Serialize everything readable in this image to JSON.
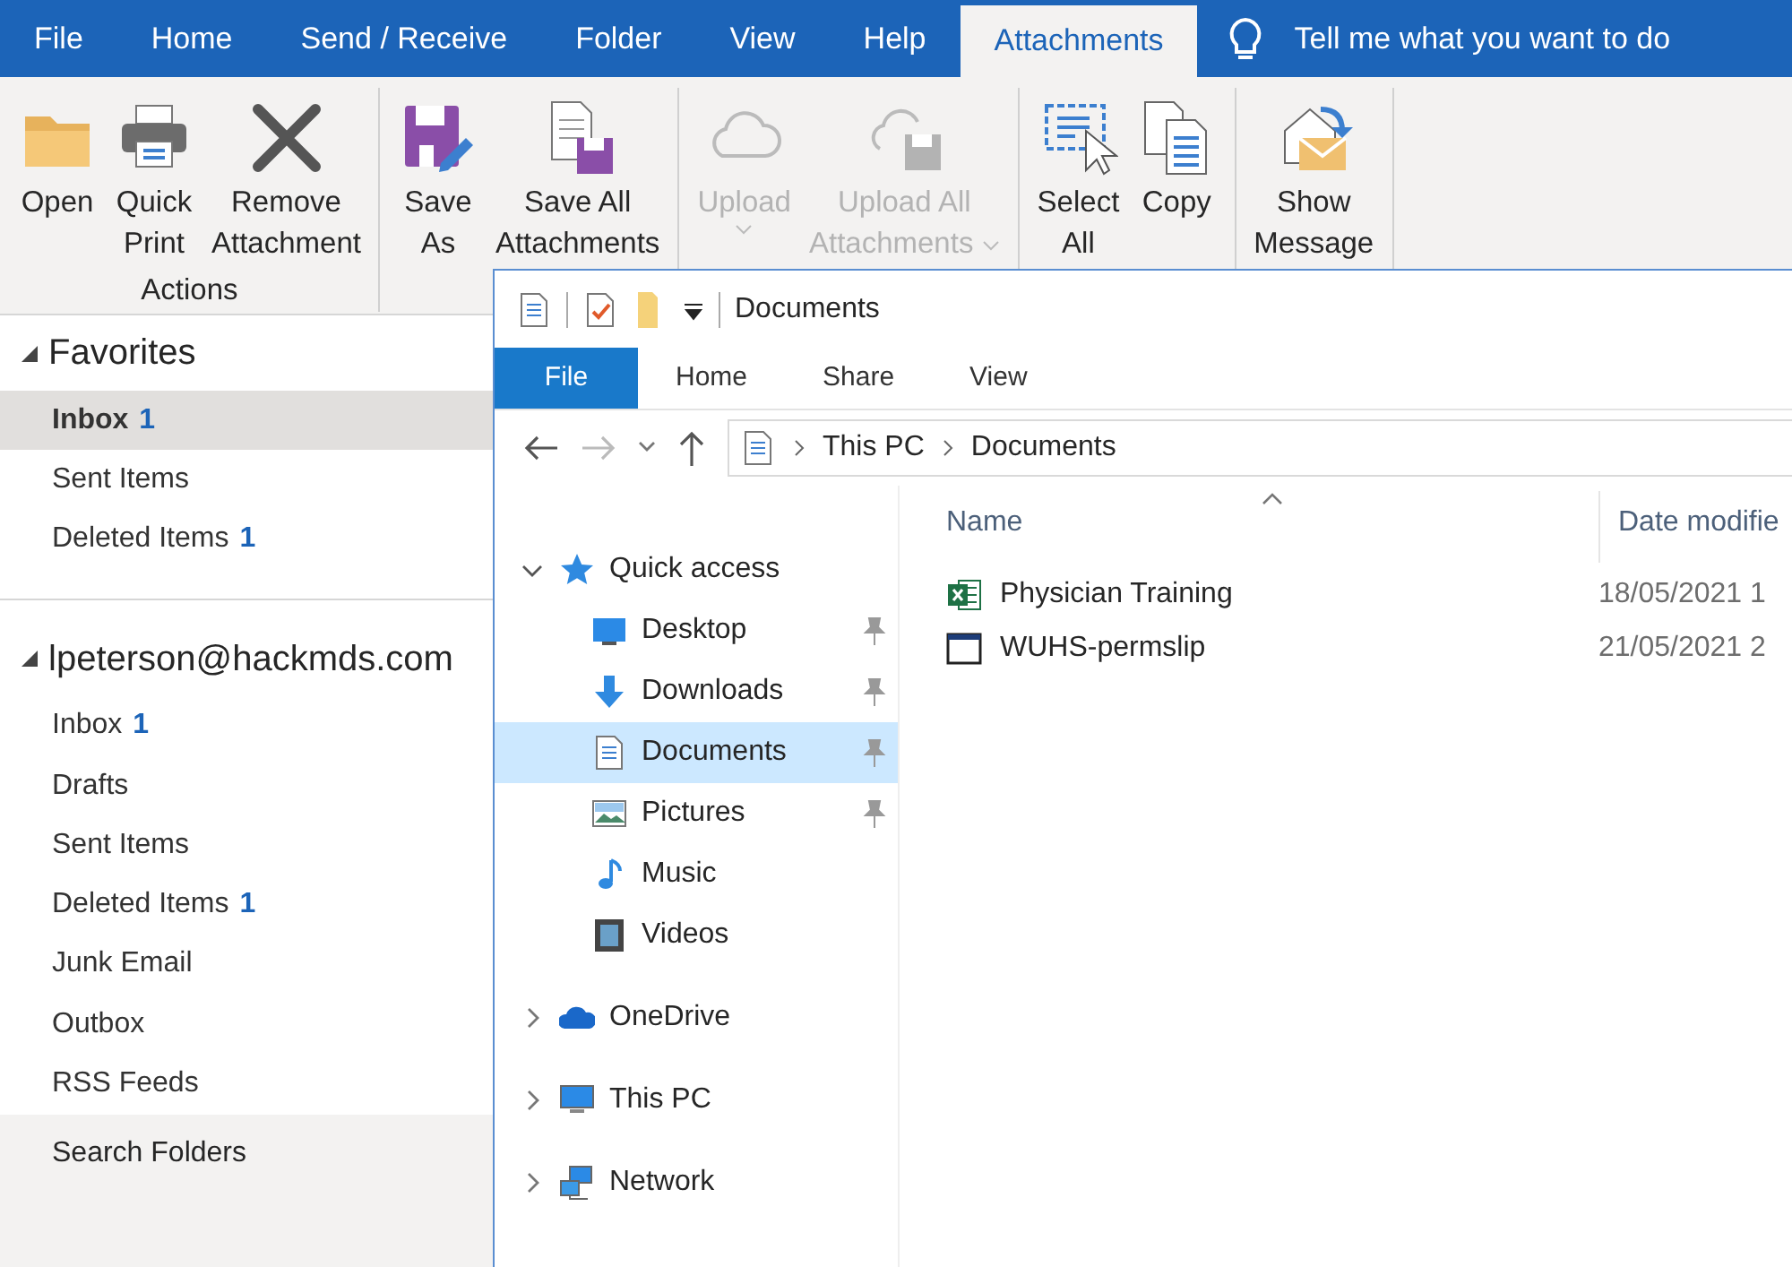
{
  "outlook": {
    "tabs": [
      {
        "label": "File",
        "selected": false
      },
      {
        "label": "Home",
        "selected": false
      },
      {
        "label": "Send / Receive",
        "selected": false
      },
      {
        "label": "Folder",
        "selected": false
      },
      {
        "label": "View",
        "selected": false
      },
      {
        "label": "Help",
        "selected": false
      },
      {
        "label": "Attachments",
        "selected": true
      }
    ],
    "tell_me": "Tell me what you want to do",
    "ribbon_groups": [
      {
        "label": "Actions",
        "buttons": [
          {
            "kind": "folder",
            "lines": [
              "Open"
            ],
            "disabled": false,
            "dropdown": false
          },
          {
            "kind": "printer",
            "lines": [
              "Quick",
              "Print"
            ],
            "disabled": false,
            "dropdown": false
          },
          {
            "kind": "remove",
            "lines": [
              "Remove",
              "Attachment"
            ],
            "disabled": false,
            "dropdown": false
          }
        ]
      },
      {
        "buttons": [
          {
            "kind": "saveas",
            "lines": [
              "Save",
              "As"
            ],
            "disabled": false,
            "dropdown": false
          },
          {
            "kind": "saveall",
            "lines": [
              "Save All",
              "Attachments"
            ],
            "disabled": false,
            "dropdown": false
          }
        ]
      },
      {
        "buttons": [
          {
            "kind": "cloud",
            "lines": [
              "Upload"
            ],
            "disabled": true,
            "dropdown": true
          },
          {
            "kind": "cloudsave",
            "lines": [
              "Upload All",
              "Attachments"
            ],
            "disabled": true,
            "dropdown": true
          }
        ]
      },
      {
        "buttons": [
          {
            "kind": "selectall",
            "lines": [
              "Select",
              "All"
            ],
            "disabled": false,
            "dropdown": false
          },
          {
            "kind": "copy",
            "lines": [
              "Copy"
            ],
            "disabled": false,
            "dropdown": false
          }
        ]
      },
      {
        "buttons": [
          {
            "kind": "showmsg",
            "lines": [
              "Show",
              "Message"
            ],
            "disabled": false,
            "dropdown": false
          }
        ]
      }
    ],
    "folder_sections": [
      {
        "title": "Favorites",
        "expanded": true,
        "items": [
          {
            "label": "Inbox",
            "count": "1",
            "selected": true
          },
          {
            "label": "Sent Items",
            "selected": false
          },
          {
            "label": "Deleted Items",
            "count": "1",
            "selected": false
          }
        ]
      },
      {
        "title": "lpeterson@hackmds.com",
        "expanded": true,
        "items": [
          {
            "label": "Inbox",
            "count": "1",
            "selected": false
          },
          {
            "label": "Drafts",
            "selected": false
          },
          {
            "label": "Sent Items",
            "selected": false
          },
          {
            "label": "Deleted Items",
            "count": "1",
            "selected": false
          },
          {
            "label": "Junk Email",
            "selected": false
          },
          {
            "label": "Outbox",
            "selected": false
          },
          {
            "label": "RSS Feeds",
            "selected": false
          }
        ]
      }
    ],
    "footer_item": "Search Folders"
  },
  "explorer": {
    "title": "Documents",
    "tabs": [
      {
        "label": "File",
        "selected": true
      },
      {
        "label": "Home",
        "selected": false
      },
      {
        "label": "Share",
        "selected": false
      },
      {
        "label": "View",
        "selected": false
      }
    ],
    "breadcrumb": [
      "This PC",
      "Documents"
    ],
    "nav_tree": [
      {
        "label": "Quick access",
        "kind": "star",
        "expanded": true,
        "children": [
          {
            "label": "Desktop",
            "kind": "desktop",
            "pinned": true,
            "selected": false
          },
          {
            "label": "Downloads",
            "kind": "download",
            "pinned": true,
            "selected": false
          },
          {
            "label": "Documents",
            "kind": "document",
            "pinned": true,
            "selected": true
          },
          {
            "label": "Pictures",
            "kind": "picture",
            "pinned": true,
            "selected": false
          },
          {
            "label": "Music",
            "kind": "music",
            "pinned": false,
            "selected": false
          },
          {
            "label": "Videos",
            "kind": "video",
            "pinned": false,
            "selected": false
          }
        ]
      },
      {
        "label": "OneDrive",
        "kind": "onedrive",
        "expanded": false
      },
      {
        "label": "This PC",
        "kind": "pc",
        "expanded": false
      },
      {
        "label": "Network",
        "kind": "network",
        "expanded": false
      }
    ],
    "columns": [
      {
        "label": "Name",
        "sorted": true
      },
      {
        "label": "Date modifie",
        "sorted": false
      }
    ],
    "files": [
      {
        "name": "Physician Training",
        "kind": "excel",
        "date": "18/05/2021 1"
      },
      {
        "name": "WUHS-permslip",
        "kind": "window",
        "date": "21/05/2021 2"
      }
    ]
  }
}
